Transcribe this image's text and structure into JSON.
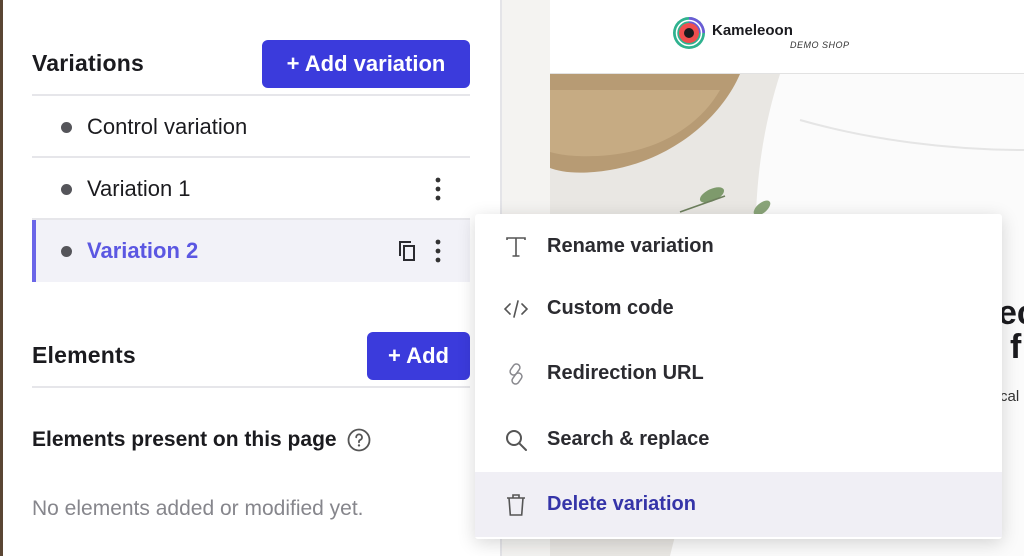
{
  "variations": {
    "title": "Variations",
    "add_button": "+ Add variation",
    "items": [
      {
        "label": "Control variation"
      },
      {
        "label": "Variation 1"
      },
      {
        "label": "Variation 2"
      }
    ]
  },
  "elements": {
    "title": "Elements",
    "add_button": "+ Add",
    "present_title": "Elements present on this page",
    "empty_text": "No elements added or modified yet."
  },
  "preview": {
    "brand": "Kameleoon",
    "brand_sub": "DEMO SHOP",
    "hero_line1": "ec",
    "hero_line2": "f",
    "hero_small": "cal"
  },
  "context_menu": {
    "items": [
      {
        "label": "Rename variation",
        "icon": "text-icon"
      },
      {
        "label": "Custom code",
        "icon": "code-icon"
      },
      {
        "label": "Redirection URL",
        "icon": "link-icon"
      },
      {
        "label": "Search & replace",
        "icon": "search-icon"
      },
      {
        "label": "Delete variation",
        "icon": "trash-icon"
      }
    ]
  },
  "colors": {
    "primary": "#3b3bdc",
    "active_text": "#5b57e2",
    "delete_text": "#3534a8"
  }
}
